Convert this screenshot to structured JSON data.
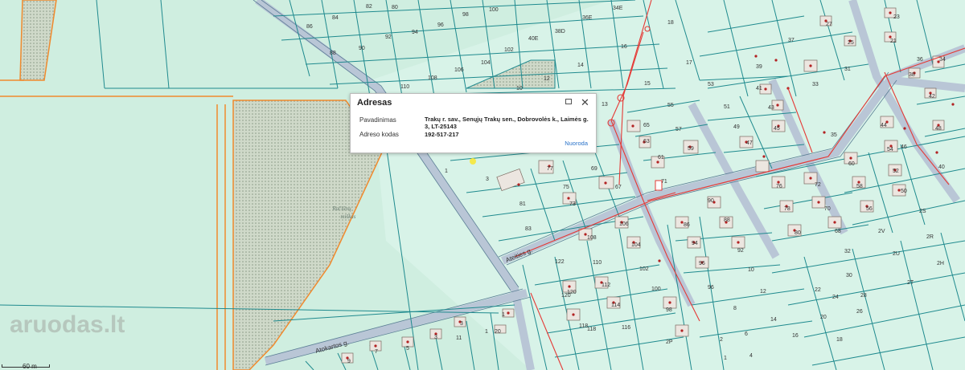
{
  "popup": {
    "title": "Adresas",
    "name_label": "Pavadinimas",
    "name_value": "Trakų r. sav., Senųjų Trakų sen., Dobrovolės k., Laimės g. 3, LT-25143",
    "code_label": "Adreso kodas",
    "code_value": "192-517-217",
    "link_label": "Nuoroda"
  },
  "map": {
    "streets": [
      "Ateities g.",
      "Atokartos g."
    ],
    "area_label": "Račiūnų miškas",
    "scale_label": "60 m",
    "parcel_labels": [
      "82",
      "80",
      "98",
      "100",
      "34E",
      "86",
      "84",
      "94",
      "96",
      "36E",
      "18",
      "92",
      "90",
      "88",
      "38D",
      "40E",
      "102",
      "104",
      "106",
      "108",
      "110",
      "14",
      "16",
      "17",
      "10",
      "12",
      "15",
      "13",
      "55",
      "53",
      "51",
      "57",
      "49",
      "69",
      "75",
      "73",
      "71",
      "77",
      "81",
      "83",
      "67",
      "106",
      "104",
      "102",
      "100",
      "98",
      "96",
      "110",
      "112",
      "114",
      "116",
      "1",
      "3",
      "5",
      "7",
      "9",
      "11",
      "122",
      "120",
      "118",
      "20",
      "2P",
      "21",
      "22",
      "24",
      "23",
      "37",
      "39",
      "41",
      "43",
      "45",
      "47",
      "33",
      "31",
      "35",
      "36",
      "38",
      "40",
      "42",
      "54",
      "56",
      "52",
      "50",
      "58",
      "60",
      "62",
      "64",
      "66",
      "72",
      "74",
      "76",
      "78",
      "94",
      "90",
      "92",
      "86",
      "88",
      "32",
      "30",
      "28",
      "26",
      "2V",
      "2U",
      "2T",
      "2R",
      "2H",
      "4",
      "6",
      "8",
      "10",
      "12",
      "14",
      "16",
      "18",
      "1",
      "2"
    ],
    "colors": {
      "background": "#cfeee0",
      "parcel_line": "#1f8a8e",
      "road": "#b9c6d6",
      "forest_border": "#f08a2e",
      "utility": "#e53935"
    }
  },
  "watermark": "aruodas.lt"
}
